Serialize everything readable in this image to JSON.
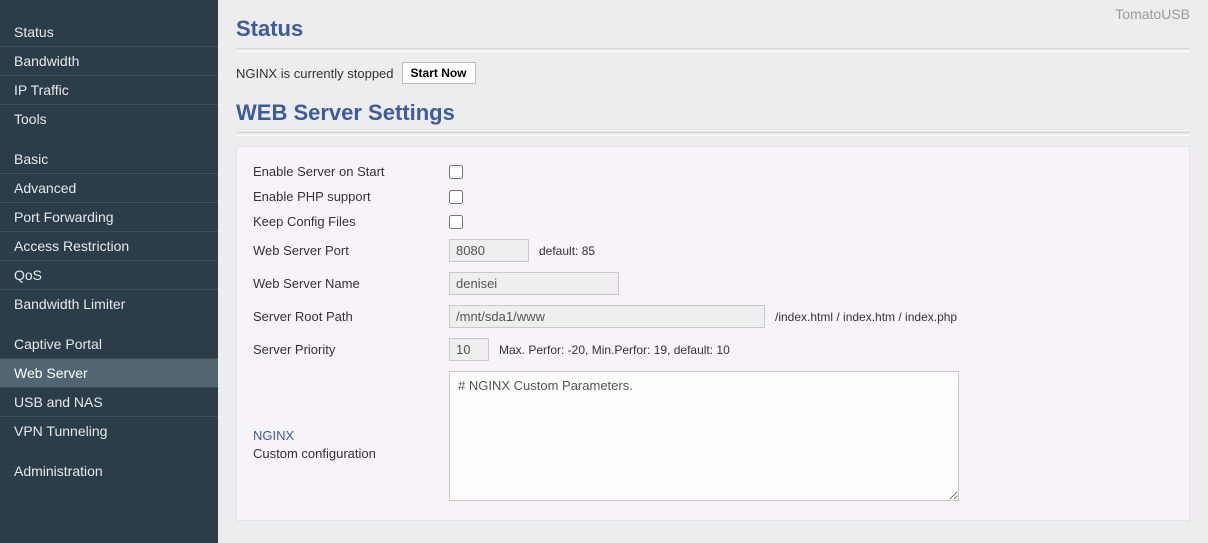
{
  "brand": "TomatoUSB",
  "sidebar": {
    "items": [
      "Status",
      "Bandwidth",
      "IP Traffic",
      "Tools",
      "Basic",
      "Advanced",
      "Port Forwarding",
      "Access Restriction",
      "QoS",
      "Bandwidth Limiter",
      "Captive Portal",
      "Web Server",
      "USB and NAS",
      "VPN Tunneling",
      "Administration"
    ],
    "active_index": 11
  },
  "status": {
    "heading": "Status",
    "text": "NGINX is currently stopped",
    "button": "Start Now"
  },
  "settings": {
    "heading": "WEB Server Settings",
    "rows": {
      "enable_on_start": {
        "label": "Enable Server on Start",
        "checked": false
      },
      "enable_php": {
        "label": "Enable PHP support",
        "checked": false
      },
      "keep_config": {
        "label": "Keep Config Files",
        "checked": false
      },
      "port": {
        "label": "Web Server Port",
        "value": "8080",
        "hint": "default: 85"
      },
      "name": {
        "label": "Web Server Name",
        "value": "denisei"
      },
      "root": {
        "label": "Server Root Path",
        "value": "/mnt/sda1/www",
        "hint": "/index.html / index.htm / index.php"
      },
      "prio": {
        "label": "Server Priority",
        "value": "10",
        "hint": "Max. Perfor: -20, Min.Perfor: 19, default: 10"
      },
      "custom": {
        "label_title": "NGINX",
        "label_sub": "Custom configuration",
        "value": "# NGINX Custom Parameters."
      }
    }
  }
}
